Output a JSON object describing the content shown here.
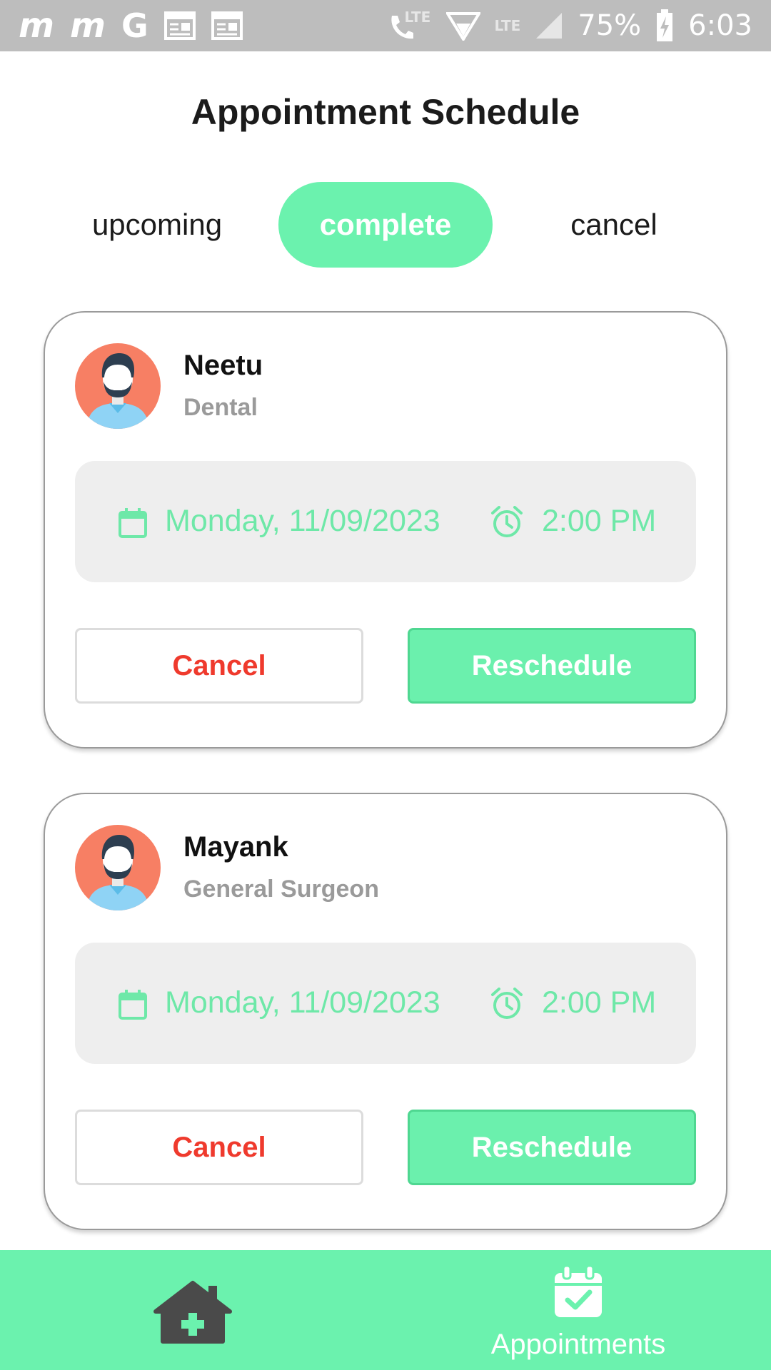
{
  "status_bar": {
    "left_icons": [
      "m-app-icon",
      "m-app-icon",
      "google-icon",
      "calendar-notification-icon",
      "calendar-notification-icon"
    ],
    "m1": "m",
    "m2": "m",
    "g": "G",
    "lte_call": "LTE",
    "lte_data": "LTE",
    "battery_percent": "75%",
    "time": "6:03"
  },
  "page": {
    "title": "Appointment Schedule"
  },
  "tabs": [
    {
      "label": "upcoming",
      "active": false
    },
    {
      "label": "complete",
      "active": true
    },
    {
      "label": "cancel",
      "active": false
    }
  ],
  "appointments": [
    {
      "name": "Neetu",
      "specialty": "Dental",
      "date": "Monday, 11/09/2023",
      "time": "2:00 PM",
      "cancel_label": "Cancel",
      "reschedule_label": "Reschedule"
    },
    {
      "name": "Mayank",
      "specialty": "General Surgeon",
      "date": "Monday, 11/09/2023",
      "time": "2:00 PM",
      "cancel_label": "Cancel",
      "reschedule_label": "Reschedule"
    }
  ],
  "bottom_nav": {
    "home_icon": "home-medical-icon",
    "appointments_label": "Appointments",
    "appointments_icon": "calendar-check-icon"
  },
  "colors": {
    "accent": "#6bf2ae",
    "accent_text": "#6ee8a8",
    "cancel_red": "#ef3a2d",
    "status_bar": "#bdbdbd",
    "datetime_bg": "#eeeeee"
  }
}
